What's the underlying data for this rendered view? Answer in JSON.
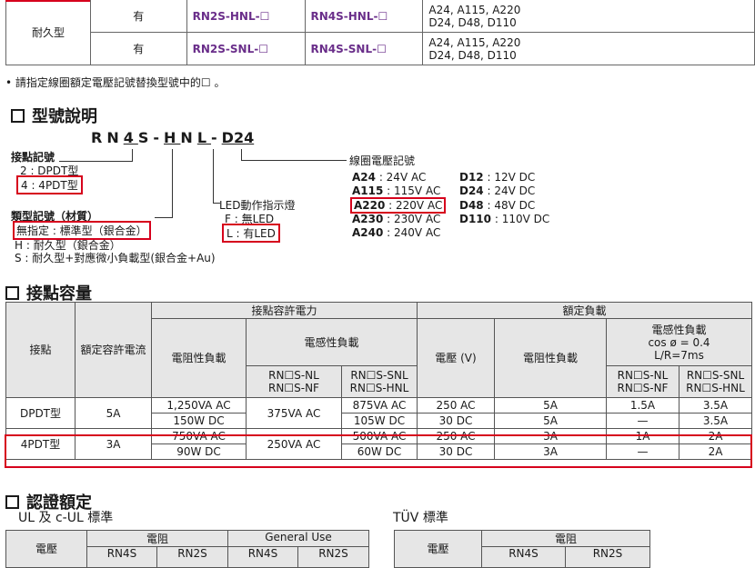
{
  "top_table": {
    "type_label": "耐久型",
    "rows": [
      {
        "led": "有",
        "model_a": "RN2S-HNL-☐",
        "model_b": "RN4S-HNL-☐",
        "volt1": "A24, A115, A220",
        "volt2": "D24, D48, D110"
      },
      {
        "led": "有",
        "model_a": "RN2S-SNL-☐",
        "model_b": "RN4S-SNL-☐",
        "volt1": "A24, A115, A220",
        "volt2": "D24, D48, D110"
      }
    ]
  },
  "note": "• 請指定線圈額定電壓記號替換型號中的☐ 。",
  "model_section": {
    "title": "型號說明",
    "code_parts": [
      "R",
      "N",
      "4",
      "S",
      "-",
      "H",
      "N",
      "L",
      "-",
      "D24"
    ],
    "contact_label": "接點記號",
    "contact_opt1": "2 : DPDT型",
    "contact_opt2": "4 : 4PDT型",
    "type_label": "類型記號（材質）",
    "type_opt1": "無指定 : 標準型（銀合金）",
    "type_opt2": "H : 耐久型（銀合金）",
    "type_opt3": "S : 耐久型+對應微小負載型(銀合金+Au)",
    "led_label": "LED動作指示燈",
    "led_opt1": "F : 無LED",
    "led_opt2": "L : 有LED",
    "coil_label": "線圈電壓記號",
    "coil_ac": [
      {
        "code": "A24",
        "val": " : 24V AC"
      },
      {
        "code": "A115",
        "val": " : 115V AC"
      },
      {
        "code": "A220",
        "val": " : 220V AC"
      },
      {
        "code": "A230",
        "val": " : 230V AC"
      },
      {
        "code": "A240",
        "val": " : 240V AC"
      }
    ],
    "coil_dc": [
      {
        "code": "D12",
        "val": " : 12V DC"
      },
      {
        "code": "D24",
        "val": " : 24V DC"
      },
      {
        "code": "D48",
        "val": " : 48V DC"
      },
      {
        "code": "D110",
        "val": " : 110V DC"
      }
    ]
  },
  "capacity": {
    "title": "接點容量",
    "h_contact": "接點",
    "h_rated_current": "額定容許電流",
    "h_allow_power": "接點容許電力",
    "h_rated_load": "額定負載",
    "h_resistive": "電阻性負載",
    "h_inductive": "電感性負載",
    "h_voltage": "電壓 (V)",
    "h_inductive_cond1": "電感性負載",
    "h_inductive_cond2": "cos ø = 0.4",
    "h_inductive_cond3": "L/R=7ms",
    "h_nl1": "RN☐S-NL",
    "h_nl2": "RN☐S-NF",
    "h_snl1": "RN☐S-SNL",
    "h_snl2": "RN☐S-HNL",
    "rows": [
      {
        "contact": "DPDT型",
        "current": "5A",
        "res_ac": "1,250VA AC",
        "res_dc": "150W DC",
        "ind_nl": "375VA AC",
        "ind_snl_ac": "875VA AC",
        "ind_snl_dc": "105W DC",
        "v_ac": "250 AC",
        "v_dc": "30 DC",
        "rl_res_ac": "5A",
        "rl_res_dc": "5A",
        "rl_nl_ac": "1.5A",
        "rl_nl_dc": "—",
        "rl_snl_ac": "3.5A",
        "rl_snl_dc": "3.5A"
      },
      {
        "contact": "4PDT型",
        "current": "3A",
        "res_ac": "750VA AC",
        "res_dc": "90W DC",
        "ind_nl": "250VA AC",
        "ind_snl_ac": "500VA AC",
        "ind_snl_dc": "60W DC",
        "v_ac": "250 AC",
        "v_dc": "30 DC",
        "rl_res_ac": "3A",
        "rl_res_dc": "3A",
        "rl_nl_ac": "1A",
        "rl_nl_dc": "—",
        "rl_snl_ac": "2A",
        "rl_snl_dc": "2A"
      }
    ]
  },
  "cert": {
    "title": "認證額定",
    "ul_title": "UL 及 c-UL 標準",
    "tuv_title": "TÜV 標準",
    "ul_h_voltage": "電壓",
    "ul_h_resist": "電阻",
    "ul_h_general": "General Use",
    "tuv_h_voltage": "電壓",
    "tuv_h_resist": "電阻",
    "col_rn4s": "RN4S",
    "col_rn2s": "RN2S"
  }
}
